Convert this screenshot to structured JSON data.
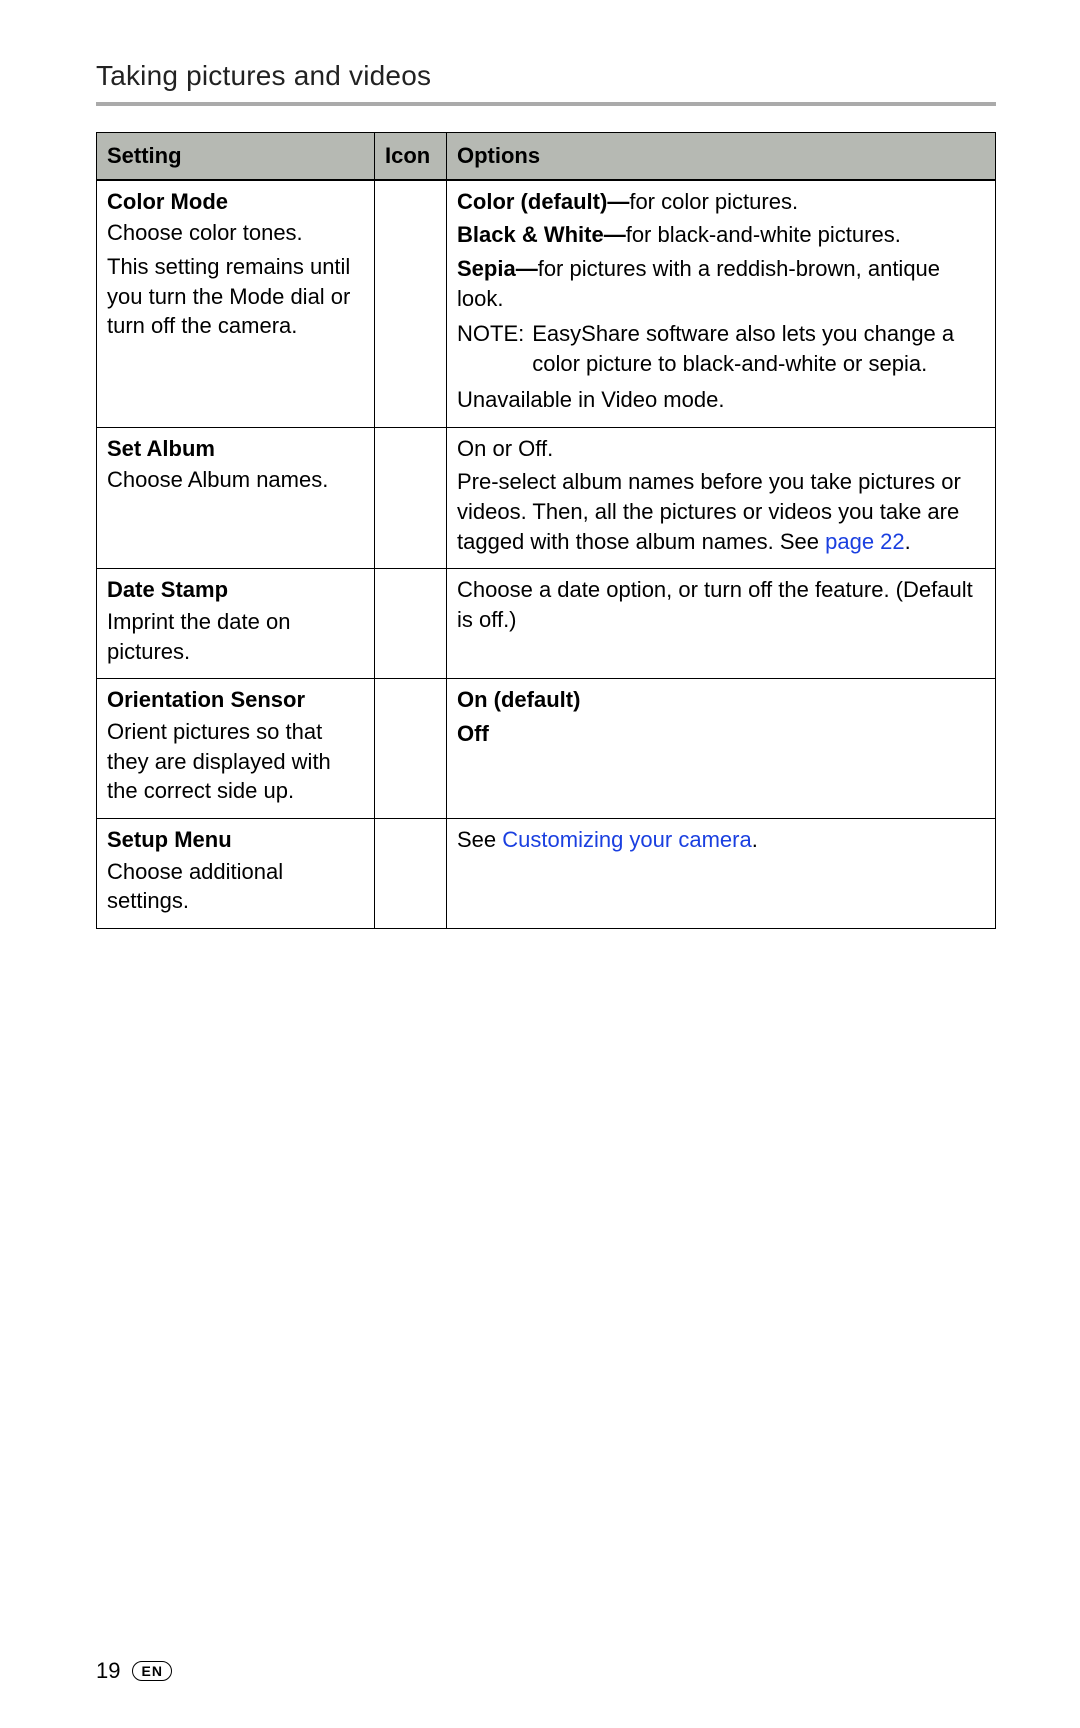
{
  "section_title": "Taking pictures and videos",
  "table": {
    "headers": {
      "setting": "Setting",
      "icon": "Icon",
      "options": "Options"
    },
    "rows": [
      {
        "title": "Color Mode",
        "sub": "Choose color tones.",
        "note": "This setting remains until you turn the Mode dial or turn off the camera.",
        "options": {
          "line1_bold": "Color (default)—",
          "line1_rest": "for color pictures.",
          "line2_bold": "Black & White—",
          "line2_rest": "for black-and-white pictures.",
          "line3_bold": "Sepia—",
          "line3_rest": "for pictures with a reddish-brown, antique look.",
          "note_label": "NOTE:",
          "note_body": "EasyShare software also lets you change a color picture to black-and-white or sepia.",
          "tail": "Unavailable in Video mode."
        }
      },
      {
        "title": "Set Album",
        "sub": "Choose Album names.",
        "options": {
          "line1": "On or Off.",
          "line2_pre": "Pre-select album names before you take pictures or videos. Then, all the pictures or videos you take are tagged with those album names. See ",
          "link": "page 22",
          "line2_post": "."
        }
      },
      {
        "title": "Date Stamp",
        "sub": "Imprint the date on pictures.",
        "options": {
          "line1": "Choose a date option, or turn off the feature. (Default is off.)"
        }
      },
      {
        "title": "Orientation Sensor",
        "sub": "Orient pictures so that they are displayed with the correct side up.",
        "options": {
          "bold1": "On (default)",
          "bold2": "Off"
        }
      },
      {
        "title": "Setup Menu",
        "sub": "Choose additional settings.",
        "options": {
          "pre": "See ",
          "link": "Customizing your camera",
          "post": "."
        }
      }
    ]
  },
  "footer": {
    "page": "19",
    "lang": "EN"
  }
}
